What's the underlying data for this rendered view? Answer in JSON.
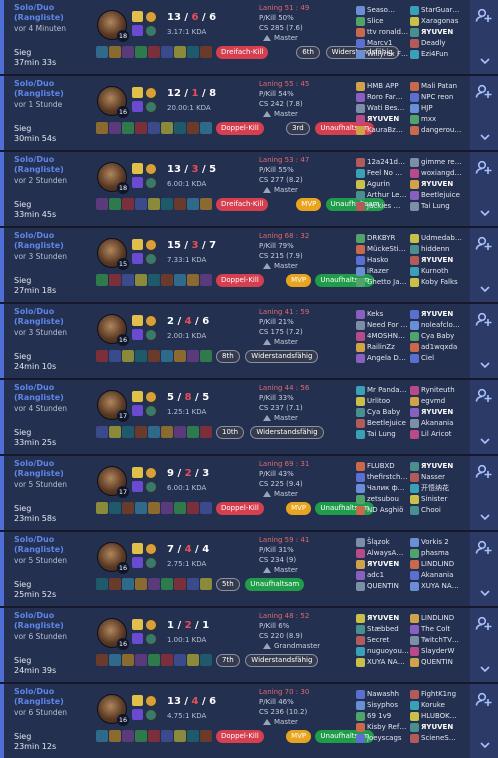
{
  "colors": {
    "win": "#4f6fd6",
    "loss": "#d24a55",
    "tag_red": "#d53f4f",
    "tag_yellow": "#e8a41f",
    "tag_green": "#1f9d4b"
  },
  "icons": {
    "more": "add-friend-icon",
    "expand": "chevron-down-icon",
    "rank": "rank-emblem-icon"
  },
  "matches": [
    {
      "queue": "Solo/Duo (Rangliste)",
      "ago": "vor 4 Minuten",
      "result": "Sieg",
      "duration": "37min 33s",
      "level": "18",
      "kda": {
        "k": "13",
        "d": "6",
        "a": "6"
      },
      "kda_ratio": "3.17:1 KDA",
      "laning": "Laning 51 : 49",
      "kp": "P/Kill 50%",
      "cs": "CS 285 (7.6)",
      "rank": "Master",
      "tags": [
        {
          "t": "Dreifach-Kill",
          "c": "red"
        },
        {
          "t": "6th",
          "c": "grey"
        },
        {
          "t": "Widerstandsfähig",
          "c": "grey"
        }
      ],
      "team1": [
        "Seaso…",
        "Slice",
        "ttv ronald…",
        "Marcv1",
        "Willyrex F…"
      ],
      "team2": [
        "StarGuar…",
        "Xaragonas",
        "ЯYUVEN",
        "Deadly",
        "Ezi4Fun"
      ],
      "me1": -1,
      "me2": 2
    },
    {
      "queue": "Solo/Duo (Rangliste)",
      "ago": "vor 1 Stunde",
      "result": "Sieg",
      "duration": "30min 54s",
      "level": "16",
      "kda": {
        "k": "12",
        "d": "1",
        "a": "8"
      },
      "kda_ratio": "20.00:1 KDA",
      "laning": "Laning 55 : 45",
      "kp": "P/Kill 54%",
      "cs": "CS 242 (7.8)",
      "rank": "Master",
      "tags": [
        {
          "t": "Doppel-Kill",
          "c": "red"
        },
        {
          "t": "3rd",
          "c": "grey"
        },
        {
          "t": "Unaufhaltsam",
          "c": "red"
        }
      ],
      "team1": [
        "HMB APP",
        "Roro Far…",
        "Wati Bes…",
        "ЯYUVEN",
        "KauraBz…"
      ],
      "team2": [
        "Mali Patan",
        "NPC reon",
        "HJP",
        "mxx",
        "dangerou…"
      ],
      "me1": 3,
      "me2": -1
    },
    {
      "queue": "Solo/Duo (Rangliste)",
      "ago": "vor 2 Stunden",
      "result": "Sieg",
      "duration": "33min 45s",
      "level": "18",
      "kda": {
        "k": "13",
        "d": "3",
        "a": "5"
      },
      "kda_ratio": "6.00:1 KDA",
      "laning": "Laning 53 : 47",
      "kp": "P/Kill 55%",
      "cs": "CS 277 (8.2)",
      "rank": "Master",
      "tags": [
        {
          "t": "Dreifach-Kill",
          "c": "red"
        },
        {
          "t": "MVP",
          "c": "yel"
        },
        {
          "t": "Unaufhaltsam",
          "c": "green"
        }
      ],
      "team1": [
        "12a241d…",
        "Feel No …",
        "Agurin",
        "Arthur Le…",
        "Jackies …"
      ],
      "team2": [
        "gimme re…",
        "woxiangd…",
        "ЯYUVEN",
        "Beetlejuice",
        "Tai Lung"
      ],
      "me1": -1,
      "me2": 2
    },
    {
      "queue": "Solo/Duo (Rangliste)",
      "ago": "vor 3 Stunden",
      "result": "Sieg",
      "duration": "27min 18s",
      "level": "15",
      "kda": {
        "k": "15",
        "d": "3",
        "a": "7"
      },
      "kda_ratio": "7.33:1 KDA",
      "laning": "Laning 68 : 32",
      "kp": "P/Kill 79%",
      "cs": "CS 215 (7.9)",
      "rank": "Master",
      "tags": [
        {
          "t": "Doppel-Kill",
          "c": "red"
        },
        {
          "t": "MVP",
          "c": "yel"
        },
        {
          "t": "Unaufhaltsam",
          "c": "green"
        }
      ],
      "team1": [
        "DRKBYR",
        "MückeSti…",
        "Hasko",
        "iRazer",
        "Ghetto Ja…"
      ],
      "team2": [
        "Udmedab…",
        "hiddenn",
        "ЯYUVEN",
        "Kurnoth",
        "Koby Falks"
      ],
      "me1": -1,
      "me2": 2
    },
    {
      "queue": "Solo/Duo (Rangliste)",
      "ago": "vor 3 Stunden",
      "result": "Sieg",
      "duration": "24min 10s",
      "level": "16",
      "kda": {
        "k": "2",
        "d": "4",
        "a": "6"
      },
      "kda_ratio": "2.00:1 KDA",
      "laning": "Laning 41 : 59",
      "kp": "P/Kill 21%",
      "cs": "CS 175 (7.2)",
      "rank": "Master",
      "tags": [
        {
          "t": "8th",
          "c": "grey"
        },
        {
          "t": "Widerstandsfähig",
          "c": "grey"
        }
      ],
      "team1": [
        "Keks",
        "Need For …",
        "4MOSHN…",
        "RailinZz",
        "Angela D…"
      ],
      "team2": [
        "ЯYUVEN",
        "noleafclo…",
        "Cya Baby",
        "ad1wqxda",
        "Ciel"
      ],
      "me1": -1,
      "me2": 0
    },
    {
      "queue": "Solo/Duo (Rangliste)",
      "ago": "vor 4 Stunden",
      "result": "Sieg",
      "duration": "33min 25s",
      "level": "17",
      "kda": {
        "k": "5",
        "d": "8",
        "a": "5"
      },
      "kda_ratio": "1.25:1 KDA",
      "laning": "Laning 44 : 56",
      "kp": "P/Kill 33%",
      "cs": "CS 237 (7.1)",
      "rank": "Master",
      "tags": [
        {
          "t": "10th",
          "c": "grey"
        },
        {
          "t": "Widerstandsfähig",
          "c": "grey"
        }
      ],
      "team1": [
        "Mr Panda…",
        "Urlitoo",
        "Cya Baby",
        "Beetlejuice",
        "Tai Lung"
      ],
      "team2": [
        "Ryniteuth",
        "egvmd",
        "ЯYUVEN",
        "Akanania",
        "Lil Aricot"
      ],
      "me1": -1,
      "me2": 2
    },
    {
      "queue": "Solo/Duo (Rangliste)",
      "ago": "vor 5 Stunden",
      "result": "Sieg",
      "duration": "23min 58s",
      "level": "17",
      "kda": {
        "k": "9",
        "d": "2",
        "a": "3"
      },
      "kda_ratio": "6.00:1 KDA",
      "laning": "Laning 69 : 31",
      "kp": "P/Kill 43%",
      "cs": "CS 225 (9.4)",
      "rank": "Master",
      "tags": [
        {
          "t": "Doppel-Kill",
          "c": "red"
        },
        {
          "t": "MVP",
          "c": "yel"
        },
        {
          "t": "Unaufhaltsam",
          "c": "green"
        }
      ],
      "team1": [
        "FLUBXD",
        "thefirstch…",
        "Чалик ф…",
        "zetsubou",
        "ND Asghiö"
      ],
      "team2": [
        "ЯYUVEN",
        "Nasser",
        "开悟纳花",
        "Sinister",
        "Chooi"
      ],
      "me1": -1,
      "me2": 0
    },
    {
      "queue": "Solo/Duo (Rangliste)",
      "ago": "vor 5 Stunden",
      "result": "Sieg",
      "duration": "25min 52s",
      "level": "16",
      "kda": {
        "k": "7",
        "d": "4",
        "a": "4"
      },
      "kda_ratio": "2.75:1 KDA",
      "laning": "Laning 59 : 41",
      "kp": "P/Kill 31%",
      "cs": "CS 234 (9)",
      "rank": "Master",
      "tags": [
        {
          "t": "5th",
          "c": "grey"
        },
        {
          "t": "Unaufhaltsam",
          "c": "green"
        }
      ],
      "team1": [
        "Šlązok",
        "AlwaysA…",
        "ЯYUVEN",
        "adc1",
        "QUENTIN"
      ],
      "team2": [
        "Vorkis 2",
        "phasma",
        "LINDLIND",
        "Akanania",
        "XUYA NA…"
      ],
      "me1": 2,
      "me2": -1
    },
    {
      "queue": "Solo/Duo (Rangliste)",
      "ago": "vor 6 Stunden",
      "result": "Sieg",
      "duration": "24min 39s",
      "level": "16",
      "kda": {
        "k": "1",
        "d": "2",
        "a": "1"
      },
      "kda_ratio": "1.00:1 KDA",
      "laning": "Laning 48 : 52",
      "kp": "P/Kill 6%",
      "cs": "CS 220 (8.9)",
      "rank": "Grandmaster",
      "tags": [
        {
          "t": "7th",
          "c": "grey"
        },
        {
          "t": "Widerstandsfähig",
          "c": "grey"
        }
      ],
      "team1": [
        "ЯYUVEN",
        "Stæbbed",
        "Secret",
        "nuguoyou…",
        "XUYA NA…"
      ],
      "team2": [
        "LINDLIND",
        "The Colt",
        "TwitchTV…",
        "SlayderW",
        "QUENTIN"
      ],
      "me1": 0,
      "me2": -1
    },
    {
      "queue": "Solo/Duo (Rangliste)",
      "ago": "vor 6 Stunden",
      "result": "Sieg",
      "duration": "23min 12s",
      "level": "16",
      "kda": {
        "k": "13",
        "d": "4",
        "a": "6"
      },
      "kda_ratio": "4.75:1 KDA",
      "laning": "Laning 70 : 30",
      "kp": "P/Kill 46%",
      "cs": "CS 236 (10.2)",
      "rank": "Master",
      "tags": [
        {
          "t": "Doppel-Kill",
          "c": "red"
        },
        {
          "t": "MVP",
          "c": "yel"
        },
        {
          "t": "Unaufhaltsam",
          "c": "green"
        }
      ],
      "team1": [
        "Nawashh",
        "Sisyphos",
        "69 1v9",
        "Kisby Ref…",
        "joeyscags"
      ],
      "team2": [
        "FightK1ng",
        "Koruke",
        "HLUBOK…",
        "ЯYUVEN",
        "ScieneS…"
      ],
      "me1": -1,
      "me2": 3
    }
  ]
}
